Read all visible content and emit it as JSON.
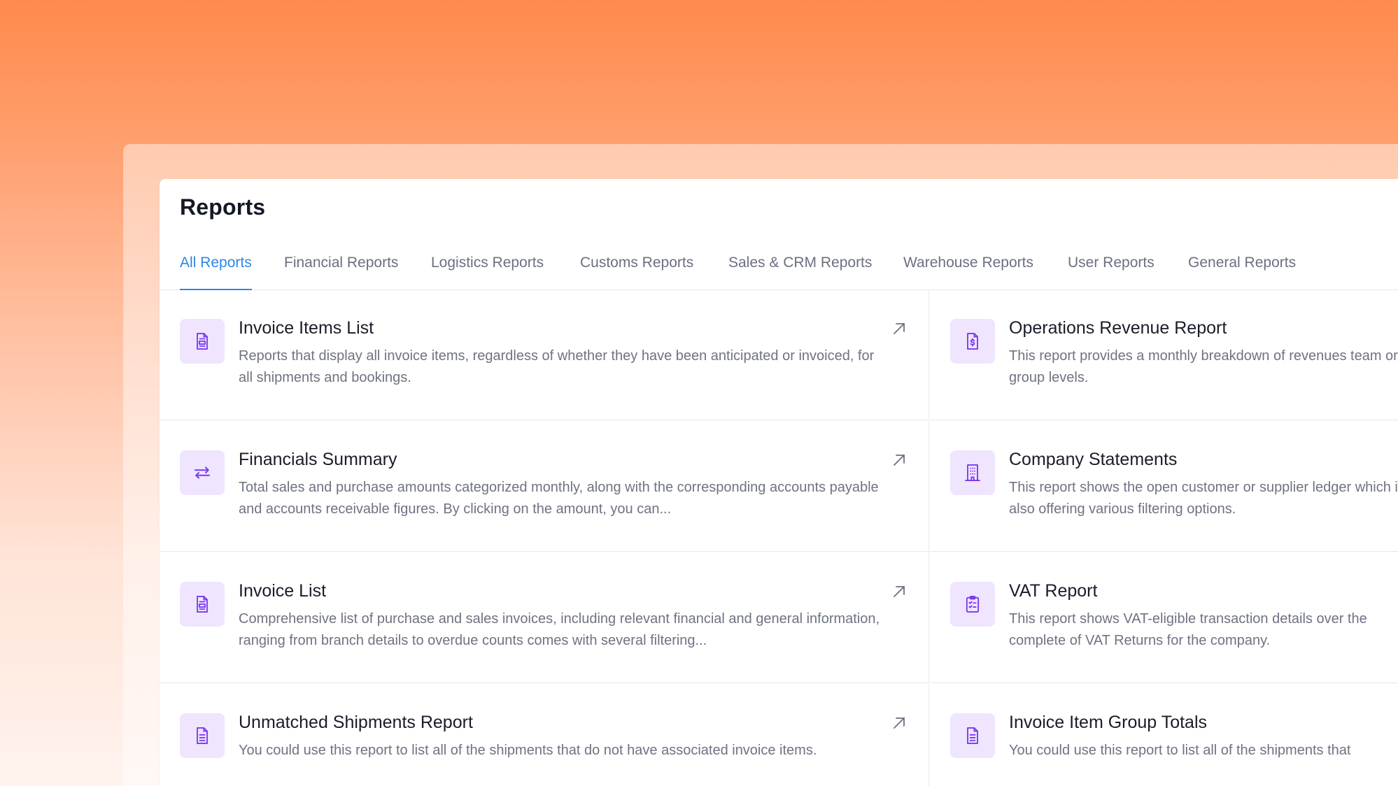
{
  "page": {
    "title": "Reports"
  },
  "tabs": [
    {
      "label": "All Reports",
      "active": true
    },
    {
      "label": "Financial Reports"
    },
    {
      "label": "Logistics Reports"
    },
    {
      "label": "Customs Reports"
    },
    {
      "label": "Sales & CRM Reports"
    },
    {
      "label": "Warehouse Reports"
    },
    {
      "label": "User Reports"
    },
    {
      "label": "General Reports"
    }
  ],
  "reports_left": [
    {
      "title": "Invoice Items List",
      "description": "Reports that display all invoice items, regardless of whether they have been anticipated or invoiced, for all shipments and bookings.",
      "icon": "invoice-icon"
    },
    {
      "title": "Financials Summary",
      "description": "Total sales and purchase amounts categorized monthly, along with the corresponding accounts payable and accounts receivable figures. By clicking on the amount, you can...",
      "icon": "transfer-arrows-icon"
    },
    {
      "title": "Invoice List",
      "description": "Comprehensive list of purchase and sales invoices, including relevant financial and general information, ranging from branch details to overdue counts comes with several filtering...",
      "icon": "invoice-icon"
    },
    {
      "title": "Unmatched Shipments Report",
      "description": "You could use this report to list all of the shipments that do not have associated invoice items.",
      "icon": "document-icon"
    }
  ],
  "reports_right": [
    {
      "title": "Operations Revenue Report",
      "description": "This report provides a monthly breakdown of revenues team or group levels.",
      "icon": "dollar-document-icon"
    },
    {
      "title": "Company Statements",
      "description": "This report shows the open customer or supplier ledger which is also offering various filtering options.",
      "icon": "building-icon"
    },
    {
      "title": "VAT Report",
      "description": "This report shows VAT-eligible transaction details over the complete of VAT Returns for the company.",
      "icon": "clipboard-check-icon"
    },
    {
      "title": "Invoice Item Group Totals",
      "description": "You could use this report to list all of the shipments that",
      "icon": "document-icon"
    }
  ],
  "colors": {
    "accent": "#2f86e8",
    "icon_bg": "#efe5ff",
    "icon_stroke": "#7c3aed",
    "title": "#1a1d29",
    "text_muted": "#6f7382"
  }
}
